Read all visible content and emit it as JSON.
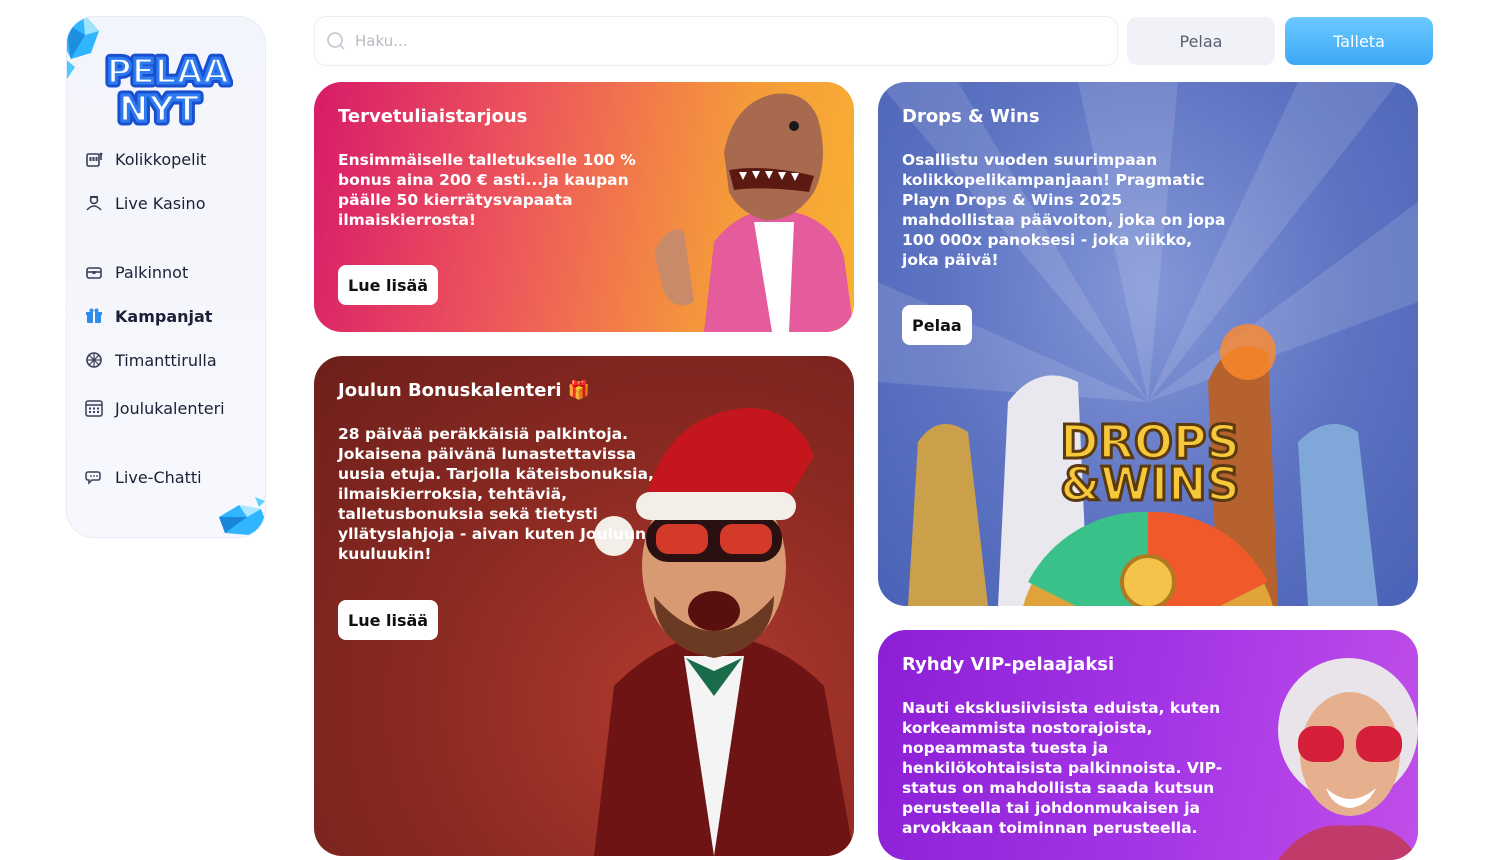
{
  "brand": {
    "logo_line1": "PELAA",
    "logo_line2": "NYT"
  },
  "sidebar": {
    "items": [
      {
        "label": "Kolikkopelit",
        "icon": "slot-machine-icon"
      },
      {
        "label": "Live Kasino",
        "icon": "live-dealer-icon"
      },
      {
        "label": "Palkinnot",
        "icon": "treasure-chest-icon"
      },
      {
        "label": "Kampanjat",
        "icon": "gift-icon",
        "active": true
      },
      {
        "label": "Timanttirulla",
        "icon": "diamond-wheel-icon"
      },
      {
        "label": "Joulukalenteri",
        "icon": "calendar-icon"
      },
      {
        "label": "Live-Chatti",
        "icon": "chat-bubble-icon"
      }
    ]
  },
  "header": {
    "search_placeholder": "Haku...",
    "play_label": "Pelaa",
    "deposit_label": "Talleta"
  },
  "cards": {
    "welcome": {
      "title": "Tervetuliaistarjous",
      "lines": [
        "Ensimmäiselle talletukselle 100 %",
        "bonus aina 200 € asti...ja kaupan",
        "päälle 50 kierrätysvapaata",
        "ilmaiskierrosta!"
      ],
      "cta": "Lue lisää"
    },
    "drops": {
      "title": "Drops & Wins",
      "lines": [
        "Osallistu vuoden suurimpaan",
        "kolikkopelikampanjaan! Pragmatic",
        "Playn Drops & Wins 2025",
        "mahdollistaa päävoiton, joka on jopa",
        "100 000x panoksesi - joka viikko,",
        "joka päivä!"
      ],
      "cta": "Pelaa",
      "art_line1": "DROPS",
      "art_line2": "&WINS"
    },
    "xmas": {
      "title": "Joulun Bonuskalenteri 🎁",
      "lines": [
        "28 päivää peräkkäisiä palkintoja.",
        "Jokaisena päivänä lunastettavissa",
        "uusia etuja. Tarjolla käteisbonuksia,",
        "ilmaiskierroksia, tehtäviä,",
        "talletusbonuksia sekä tietysti",
        "yllätyslahjoja - aivan kuten Jouluun",
        "kuuluukin!"
      ],
      "cta": "Lue lisää"
    },
    "vip": {
      "title": "Ryhdy VIP-pelaajaksi",
      "lines": [
        "Nauti eksklusiivisista eduista, kuten",
        "korkeammista nostorajoista,",
        "nopeammasta tuesta ja",
        "henkilökohtaisista palkinnoista. VIP-",
        "status on mahdollista saada kutsun",
        "perusteella tai johdonmukaisen ja",
        "arvokkaan toiminnan perusteella."
      ]
    }
  },
  "colors": {
    "accent": "#3aa8f5",
    "welcome": "#e23a6b",
    "drops": "#5d73c2",
    "xmas": "#8a2a22",
    "vip": "#a334e6"
  }
}
